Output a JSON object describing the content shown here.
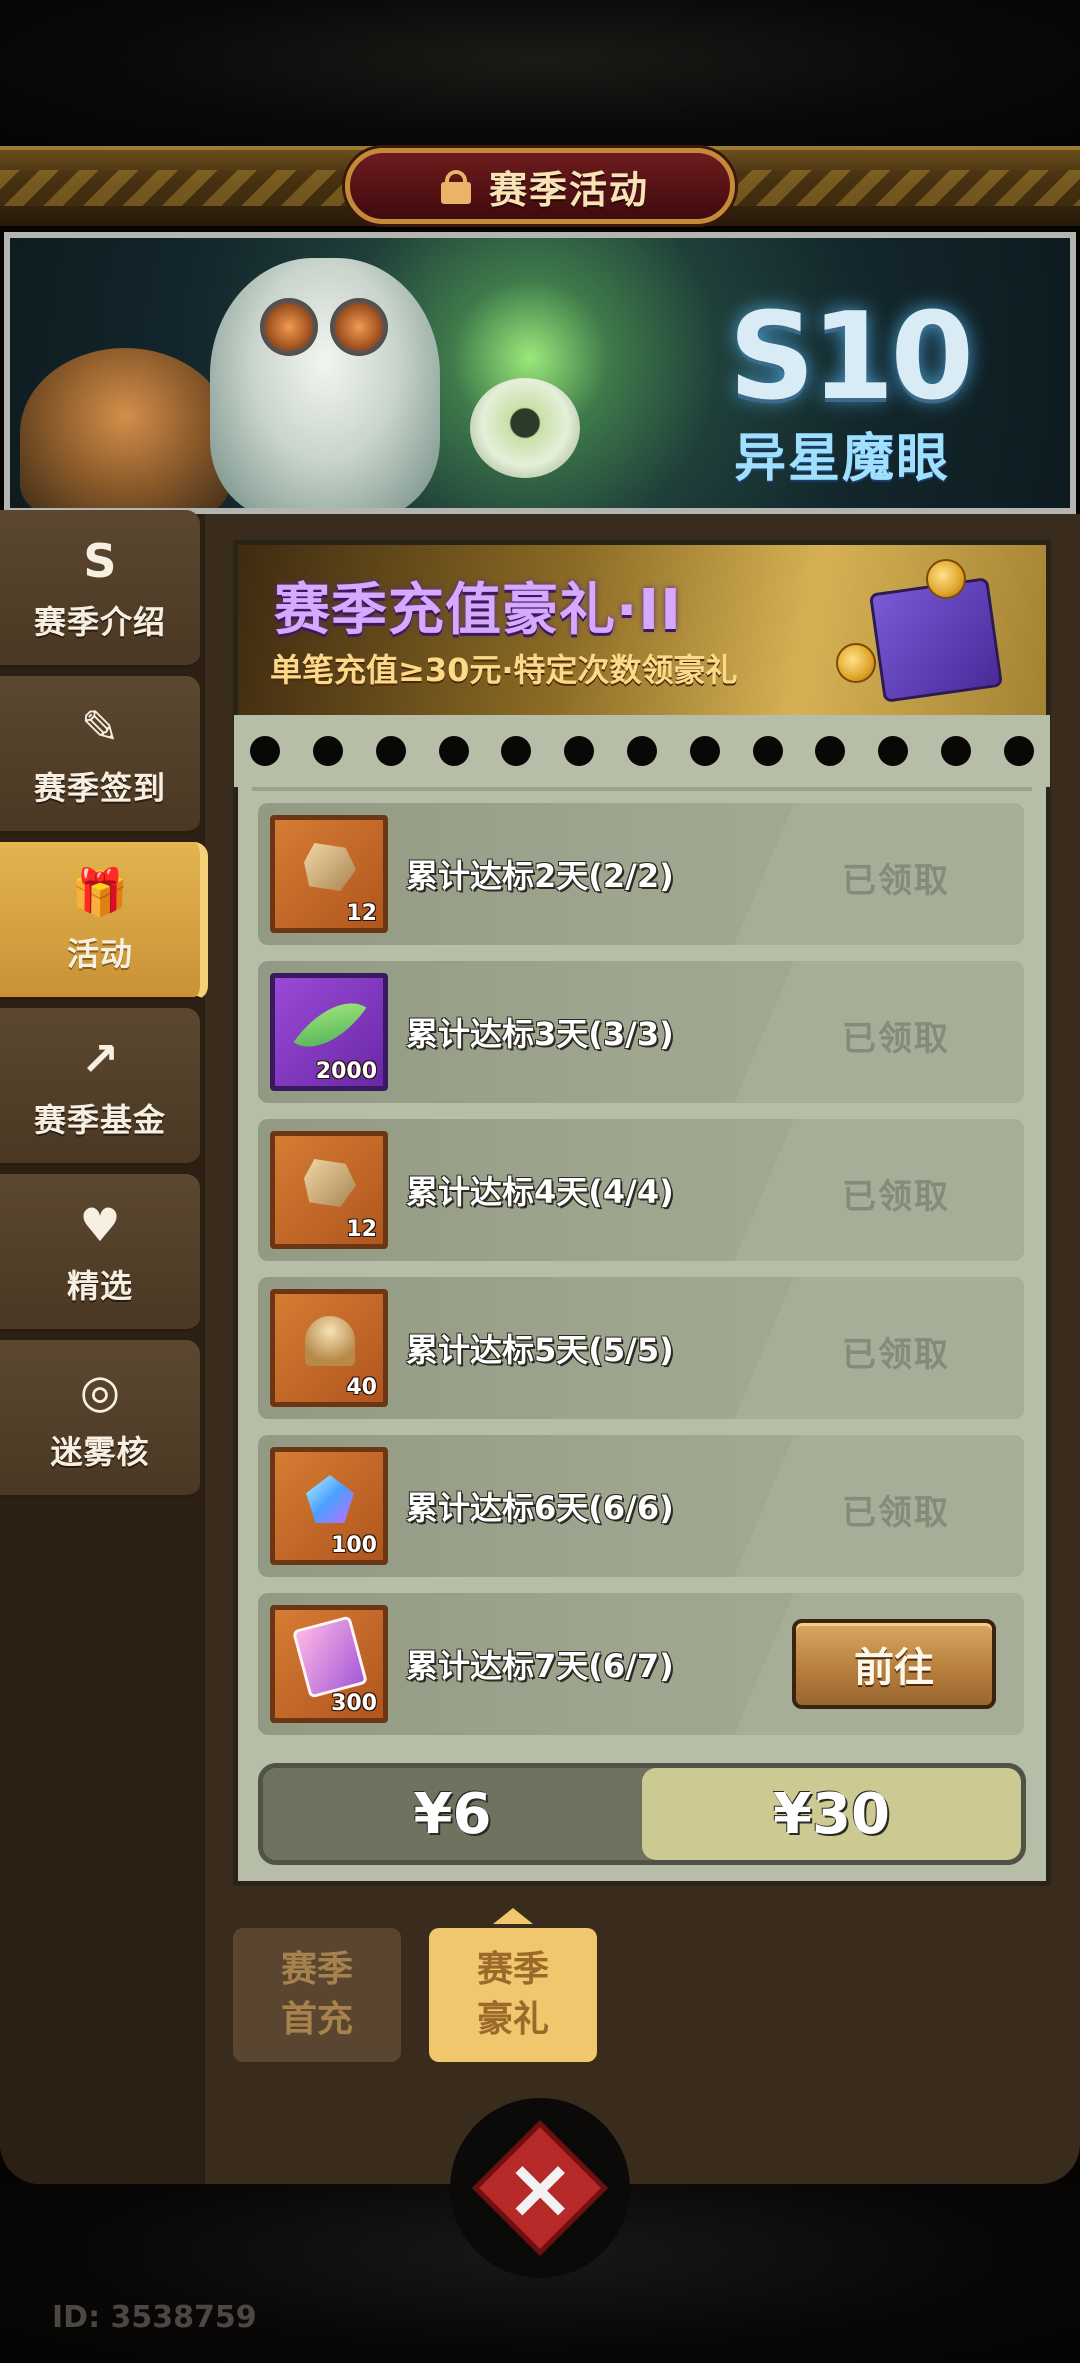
{
  "header": {
    "title": "赛季活动",
    "icon": "gift-icon"
  },
  "banner": {
    "season_code": "S10",
    "season_name": "异星魔眼"
  },
  "sidebar": {
    "items": [
      {
        "label": "赛季介绍",
        "icon": "S",
        "icon_name": "season-s-icon",
        "active": false
      },
      {
        "label": "赛季签到",
        "icon": "✎",
        "icon_name": "pen-icon",
        "active": false
      },
      {
        "label": "活动",
        "icon": "🎁",
        "icon_name": "gift-icon",
        "active": true
      },
      {
        "label": "赛季基金",
        "icon": "↗",
        "icon_name": "growth-arrow-icon",
        "active": false
      },
      {
        "label": "精选",
        "icon": "♥",
        "icon_name": "heart-icon",
        "active": false
      },
      {
        "label": "迷雾核",
        "icon": "◎",
        "icon_name": "core-icon",
        "active": false
      }
    ]
  },
  "promo": {
    "title": "赛季充值豪礼·II",
    "subtitle": "单笔充值≥30元·特定次数领豪礼"
  },
  "tasks": [
    {
      "label": "累计达标2天(2/2)",
      "qty": "12",
      "reward_icon": "ore-icon",
      "status": "已领取"
    },
    {
      "label": "累计达标3天(3/3)",
      "qty": "2000",
      "reward_icon": "green-crystal-icon",
      "status": "已领取"
    },
    {
      "label": "累计达标4天(4/4)",
      "qty": "12",
      "reward_icon": "ore-icon",
      "status": "已领取"
    },
    {
      "label": "累计达标5天(5/5)",
      "qty": "40",
      "reward_icon": "bell-icon",
      "status": "已领取"
    },
    {
      "label": "累计达标6天(6/6)",
      "qty": "100",
      "reward_icon": "gem-icon",
      "status": "已领取"
    },
    {
      "label": "累计达标7天(6/7)",
      "qty": "300",
      "reward_icon": "cards-icon",
      "action": "前往"
    }
  ],
  "price_options": [
    {
      "label": "¥6",
      "selected": false
    },
    {
      "label": "¥30",
      "selected": true
    }
  ],
  "bottom_tabs": [
    {
      "line1": "赛季",
      "line2": "首充",
      "active": false
    },
    {
      "line1": "赛季",
      "line2": "豪礼",
      "active": true
    }
  ],
  "footer": {
    "user_id": "ID: 3538759"
  },
  "colors": {
    "active_tab": "#e3b450",
    "panel_bg": "#b6bea8",
    "go_button": "#b8803e",
    "claimed_text": "#858b7a"
  }
}
